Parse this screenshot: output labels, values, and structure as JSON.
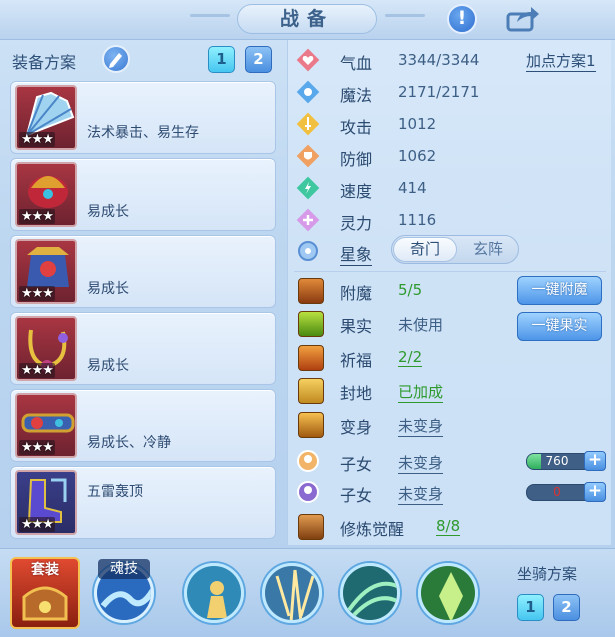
{
  "header": {
    "title": "战备"
  },
  "equipment_panel": {
    "scheme_label": "装备方案",
    "scheme_buttons": [
      "1",
      "2"
    ],
    "items": [
      {
        "text": "法术暴击、易生存",
        "stars": "★★★"
      },
      {
        "text": "易成长",
        "stars": "★★★"
      },
      {
        "text": "易成长",
        "stars": "★★★"
      },
      {
        "text": "易成长",
        "stars": "★★★"
      },
      {
        "text": "易成长、冷静",
        "stars": "★★★"
      },
      {
        "text": "五雷轰顶",
        "stars": "★★★"
      }
    ]
  },
  "stats": {
    "add_point_scheme": "加点方案1",
    "rows": [
      {
        "name": "气血",
        "value": "3344/3344"
      },
      {
        "name": "魔法",
        "value": "2171/2171"
      },
      {
        "name": "攻击",
        "value": "1012"
      },
      {
        "name": "防御",
        "value": "1062"
      },
      {
        "name": "速度",
        "value": "414"
      },
      {
        "name": "灵力",
        "value": "1116"
      }
    ],
    "star_label": "星象",
    "star_tabs": [
      "奇门",
      "玄阵"
    ]
  },
  "enhance": {
    "rows": [
      {
        "name": "附魔",
        "value": "5/5"
      },
      {
        "name": "果实",
        "value": "未使用"
      },
      {
        "name": "祈福",
        "value": "2/2"
      },
      {
        "name": "封地",
        "value": "已加成"
      },
      {
        "name": "变身",
        "value": "未变身"
      },
      {
        "name": "子女",
        "value": "未变身"
      },
      {
        "name": "子女",
        "value": "未变身"
      },
      {
        "name": "修炼觉醒",
        "value": "8/8"
      }
    ],
    "one_click_enchant": "一键附魔",
    "one_click_fruit": "一键果实",
    "child_bars": [
      {
        "value": "760",
        "fill": 0.2
      },
      {
        "value": "0",
        "fill": 0
      }
    ],
    "plus": "+"
  },
  "bottom": {
    "set_label": "套装",
    "soul_label": "魂技",
    "mount_label": "坐骑方案",
    "mount_buttons": [
      "1",
      "2"
    ]
  },
  "colors": {
    "accent": "#4a8fe0",
    "green": "#2e9a2e",
    "red": "#e03030"
  }
}
